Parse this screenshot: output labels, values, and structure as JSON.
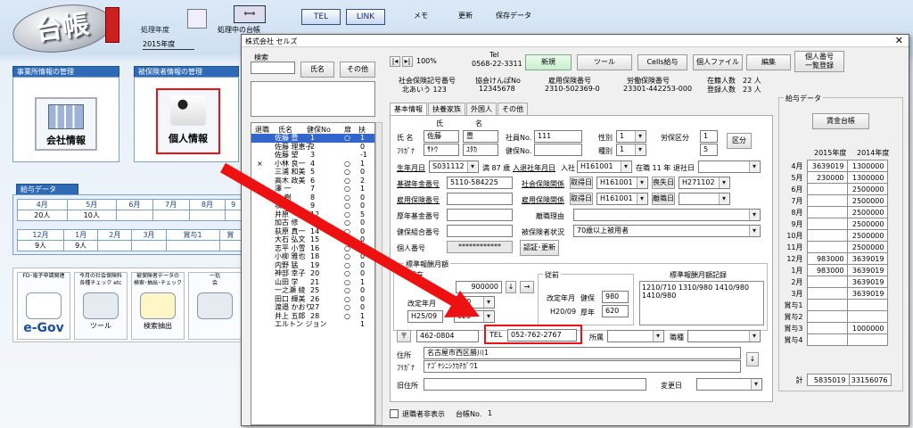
{
  "main": {
    "logo": "台帳",
    "processing_year_label": "処理年度",
    "processing_year": "2015年度",
    "processing_month_label": "処理中の台帳",
    "tel_button": "TEL",
    "link_button": "LINK",
    "memo_label": "メモ",
    "update_label": "更新",
    "save_label": "保存データ",
    "section_office": "事業所情報の管理",
    "section_insured": "被保険者情報の管理",
    "company_info": "会社情報",
    "personal_info": "個人情報",
    "payroll_header": "給与データ",
    "months_row1": [
      "4月",
      "5月",
      "6月",
      "7月",
      "8月",
      "9"
    ],
    "counts_row1": [
      "20人",
      "10人",
      "",
      "",
      "",
      ""
    ],
    "months_row2": [
      "12月",
      "1月",
      "2月",
      "3月",
      "賞与1",
      "賞"
    ],
    "counts_row2": [
      "9人",
      "9人",
      "",
      "",
      "",
      ""
    ],
    "bottom_icons": [
      {
        "title": "FD･電子申請関連",
        "label": "e-Gov"
      },
      {
        "title": "今月の社会保険料\n各種チェック etc",
        "label": "ツール"
      },
      {
        "title": "被保険者データの\n検索･抽出･チェック",
        "label": "検索抽出"
      },
      {
        "title": "一括\n会",
        "label": ""
      }
    ]
  },
  "dialog": {
    "title": "株式会社 セルズ",
    "search": {
      "label": "検索",
      "name_btn": "氏名",
      "other_btn": "その他"
    },
    "list_headers": [
      "退職",
      "氏名",
      "健保No",
      "扉",
      "扶"
    ],
    "employees": [
      {
        "ret": "",
        "name": "佐藤 豊",
        "no": "1",
        "door": "○",
        "dep": "1",
        "sel": true
      },
      {
        "ret": "",
        "name": "佐藤 理恵子",
        "no": "2",
        "door": "",
        "dep": "0"
      },
      {
        "ret": "",
        "name": "佐藤 望",
        "no": "3",
        "door": "",
        "dep": "-1"
      },
      {
        "ret": "×",
        "name": "小林 良一",
        "no": "4",
        "door": "○",
        "dep": "1"
      },
      {
        "ret": "",
        "name": "三浦 和美",
        "no": "5",
        "door": "○",
        "dep": "0"
      },
      {
        "ret": "",
        "name": "高木 政美",
        "no": "6",
        "door": "○",
        "dep": "2"
      },
      {
        "ret": "",
        "name": "澤 一",
        "no": "7",
        "door": "○",
        "dep": "1"
      },
      {
        "ret": "",
        "name": "木 樹",
        "no": "8",
        "door": "○",
        "dep": "0"
      },
      {
        "ret": "",
        "name": "坂",
        "no": "9",
        "door": "○",
        "dep": "0"
      },
      {
        "ret": "",
        "name": "井原",
        "no": "12",
        "door": "○",
        "dep": "5"
      },
      {
        "ret": "",
        "name": "加古 修",
        "no": "13",
        "door": "○",
        "dep": "0"
      },
      {
        "ret": "",
        "name": "荻原 真一",
        "no": "14",
        "door": "○",
        "dep": "0"
      },
      {
        "ret": "",
        "name": "大石 弘文",
        "no": "15",
        "door": "",
        "dep": "0"
      },
      {
        "ret": "",
        "name": "志平 小雪",
        "no": "16",
        "door": "○",
        "dep": "0"
      },
      {
        "ret": "",
        "name": "小柳 雅也",
        "no": "18",
        "door": "○",
        "dep": "0"
      },
      {
        "ret": "",
        "name": "内野 猛",
        "no": "19",
        "door": "○",
        "dep": "0"
      },
      {
        "ret": "",
        "name": "神部 幸子",
        "no": "20",
        "door": "○",
        "dep": "0"
      },
      {
        "ret": "",
        "name": "山田 学",
        "no": "21",
        "door": "○",
        "dep": "1"
      },
      {
        "ret": "",
        "name": "一之瀬 綾",
        "no": "25",
        "door": "○",
        "dep": "0"
      },
      {
        "ret": "",
        "name": "田口 輝美",
        "no": "26",
        "door": "○",
        "dep": "0"
      },
      {
        "ret": "",
        "name": "渡邉 かおり",
        "no": "27",
        "door": "○",
        "dep": "0"
      },
      {
        "ret": "",
        "name": "井上 五郎",
        "no": "28",
        "door": "○",
        "dep": "1"
      },
      {
        "ret": "",
        "name": "エルトン ジョン",
        "no": "",
        "door": "",
        "dep": "1"
      }
    ],
    "nav": {
      "pct": "100%",
      "tel_label": "Tel",
      "tel": "0568-22-3311"
    },
    "toolbar": {
      "new": "新規",
      "tool": "ツール",
      "cells": "Cells給与",
      "personal_file": "個人ファイル",
      "edit": "編集",
      "my_number": "個人番号\n一覧登録"
    },
    "company_numbers": {
      "shaho_label": "社会保険記号番号",
      "shaho": "北あいう 123",
      "kyokai_label": "協会けんぽNo",
      "kyokai": "12345678",
      "koyo_label": "雇用保険番号",
      "koyo": "2310-502369-0",
      "rodo_label": "労働保険番号",
      "rodo": "23301-442253-000",
      "zaiseki_label": "在籍人数",
      "zaiseki": "22 人",
      "toroku_label": "登録人数",
      "toroku": "23 人"
    },
    "tabs": [
      "基本情報",
      "扶養家族",
      "外国人",
      "その他"
    ],
    "form": {
      "shi_label": "氏",
      "mei_label": "名",
      "name_label": "氏 名",
      "last": "佐藤",
      "first": "豊",
      "furi_label": "ﾌﾘｶﾞﾅ",
      "last_kana": "ｻﾄｳ",
      "first_kana": "ﾕﾀｶ",
      "emp_no_label": "社員No.",
      "emp_no": "111",
      "kenpo_label": "健保No.",
      "kenpo": "",
      "sex_label": "性別",
      "sex": "1",
      "kind_label": "種別",
      "kind": "1",
      "rousai_label": "労保区分",
      "rousai": "1",
      "rousai2": "5",
      "kubun_btn": "区分",
      "birth_label": "生年月日",
      "birth": "S031112",
      "age": "満 87 歳",
      "join_label": "入退社年月日",
      "join_prefix": "入社",
      "join": "H161001",
      "tenure": "在職 11 年",
      "quit": "退社日",
      "pension_label": "基礎年金番号",
      "pension": "5110-584225",
      "shaho_rel_label": "社会保険関係",
      "shaho_get": "取得日",
      "shaho_date": "H161001",
      "shaho_loss": "喪失日",
      "shaho_loss_date": "H271102",
      "koyo_no_label": "雇用保険番号",
      "koyo_rel_label": "雇用保険関係",
      "koyo_get": "取得日",
      "koyo_date": "H161001",
      "koyo_loss": "離職日",
      "kousei_label": "厚年基金番号",
      "riyu_label": "離職理由",
      "kumiai_label": "健保組合番号",
      "status_label": "被保険者状況",
      "status": "70歳以上被用者",
      "mynum_label": "個人番号",
      "mynum": "************",
      "auth_btn": "認証･更新",
      "std_label": "標準報酬月額",
      "current_label": "現在",
      "std_amount": "900000",
      "std_grade1": "980",
      "kaitei_label": "改定年月",
      "kaitei_date": "H25/09",
      "std_grade2": "620",
      "prev_label": "従前",
      "prev_kaitei": "改定年月",
      "kenpo_lbl": "健保",
      "prev_kenpo": "980",
      "prev_date": "H20/09",
      "kounen_lbl": "厚年",
      "prev_kounen": "620",
      "history_label": "標準報酬月額記録",
      "history": "1210/710 1310/980 1410/980\n1410/980",
      "zip_icon": "〒",
      "zip": "462-0804",
      "tel_lbl": "TEL",
      "tel": "052-762-2767",
      "dept_label": "所属",
      "post_label": "職種",
      "addr_label": "住所",
      "addr": "名古屋市西区勝川1",
      "addr_kana_label": "ﾌﾘｶﾞﾅ",
      "addr_kana": "ﾅｺﾞﾔｼﾆｼｸｶﾁｶﾞﾜ1",
      "old_addr_label": "旧住所",
      "change_label": "変更日"
    },
    "footer": {
      "hide_retired": "退職者非表示",
      "ledger": "台帳No.",
      "ledger_no": "1"
    },
    "salary": {
      "title": "給与データ",
      "book_btn": "賃金台帳",
      "col1": "2015年度",
      "col2": "2014年度",
      "rows": [
        {
          "m": "4月",
          "a": "3639019",
          "b": "1300000"
        },
        {
          "m": "5月",
          "a": "230000",
          "b": "1300000"
        },
        {
          "m": "6月",
          "a": "",
          "b": "2500000"
        },
        {
          "m": "7月",
          "a": "",
          "b": "2500000"
        },
        {
          "m": "8月",
          "a": "",
          "b": "2500000"
        },
        {
          "m": "9月",
          "a": "",
          "b": "2500000"
        },
        {
          "m": "10月",
          "a": "",
          "b": "2500000"
        },
        {
          "m": "11月",
          "a": "",
          "b": "2500000"
        },
        {
          "m": "12月",
          "a": "983000",
          "b": "3639019"
        },
        {
          "m": "1月",
          "a": "983000",
          "b": "3639019"
        },
        {
          "m": "2月",
          "a": "",
          "b": "3639019"
        },
        {
          "m": "3月",
          "a": "",
          "b": "3639019"
        },
        {
          "m": "賞与1",
          "a": "",
          "b": ""
        },
        {
          "m": "賞与2",
          "a": "",
          "b": ""
        },
        {
          "m": "賞与3",
          "a": "",
          "b": "1000000"
        },
        {
          "m": "賞与4",
          "a": "",
          "b": ""
        }
      ],
      "total_label": "計",
      "total_a": "5835019",
      "total_b": "33156076"
    }
  },
  "colors": {
    "accent": "#2f6ab6",
    "highlight": "#e11111",
    "selected": "#3366cc"
  }
}
